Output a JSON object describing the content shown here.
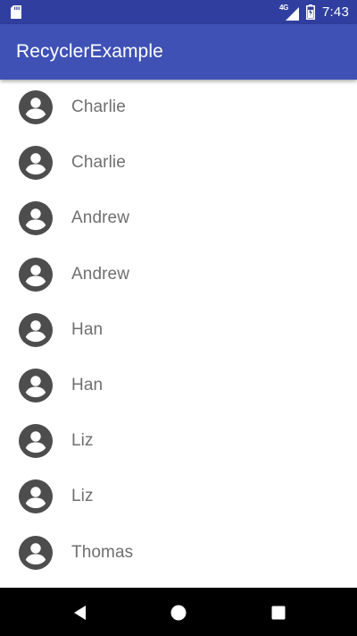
{
  "status_bar": {
    "time": "7:43",
    "network": "4G",
    "icons": [
      "sd-card-icon",
      "signal-icon",
      "battery-icon"
    ]
  },
  "app_bar": {
    "title": "RecyclerExample",
    "color": "#3f51b5",
    "status_color": "#303f9f"
  },
  "contacts": [
    {
      "name": "Charlie",
      "icon": "account-circle-icon"
    },
    {
      "name": "Charlie",
      "icon": "account-circle-icon"
    },
    {
      "name": "Andrew",
      "icon": "account-circle-icon"
    },
    {
      "name": "Andrew",
      "icon": "account-circle-icon"
    },
    {
      "name": "Han",
      "icon": "account-circle-icon"
    },
    {
      "name": "Han",
      "icon": "account-circle-icon"
    },
    {
      "name": "Liz",
      "icon": "account-circle-icon"
    },
    {
      "name": "Liz",
      "icon": "account-circle-icon"
    },
    {
      "name": "Thomas",
      "icon": "account-circle-icon"
    }
  ],
  "nav_bar": {
    "buttons": [
      "back-icon",
      "home-icon",
      "recents-icon"
    ]
  }
}
